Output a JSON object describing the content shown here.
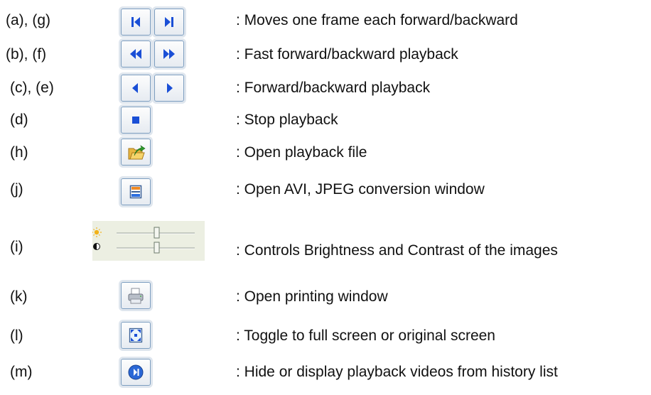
{
  "rows": [
    {
      "label": "(a), (g)",
      "description": ": Moves one frame each forward/backward",
      "icons": [
        "step-back-icon",
        "step-forward-icon"
      ]
    },
    {
      "label": "(b), (f)",
      "description": ": Fast forward/backward playback",
      "icons": [
        "fast-backward-icon",
        "fast-forward-icon"
      ]
    },
    {
      "label": "(c), (e)",
      "description": ": Forward/backward playback",
      "icons": [
        "play-backward-icon",
        "play-forward-icon"
      ]
    },
    {
      "label": "(d)",
      "description": ": Stop playback",
      "icons": [
        "stop-icon"
      ]
    },
    {
      "label": "(h)",
      "description": ": Open playback file",
      "icons": [
        "open-folder-icon"
      ]
    },
    {
      "label": "(j)",
      "description": ": Open AVI, JPEG conversion window",
      "icons": [
        "conversion-window-icon"
      ]
    },
    {
      "label": "(i)",
      "description": ": Controls Brightness and Contrast of the images",
      "icons": [
        "brightness-icon",
        "contrast-icon"
      ]
    },
    {
      "label": "(k)",
      "description": ": Open printing window",
      "icons": [
        "printer-icon"
      ]
    },
    {
      "label": "(l)",
      "description": ": Toggle to full screen or original screen",
      "icons": [
        "fullscreen-icon"
      ]
    },
    {
      "label": "(m)",
      "description": ": Hide or display playback videos from history list",
      "icons": [
        "history-toggle-icon"
      ]
    }
  ],
  "colors": {
    "icon_blue": "#1a4fd6",
    "button_border": "#7d9ec0",
    "slider_panel": "#ecefe2"
  }
}
